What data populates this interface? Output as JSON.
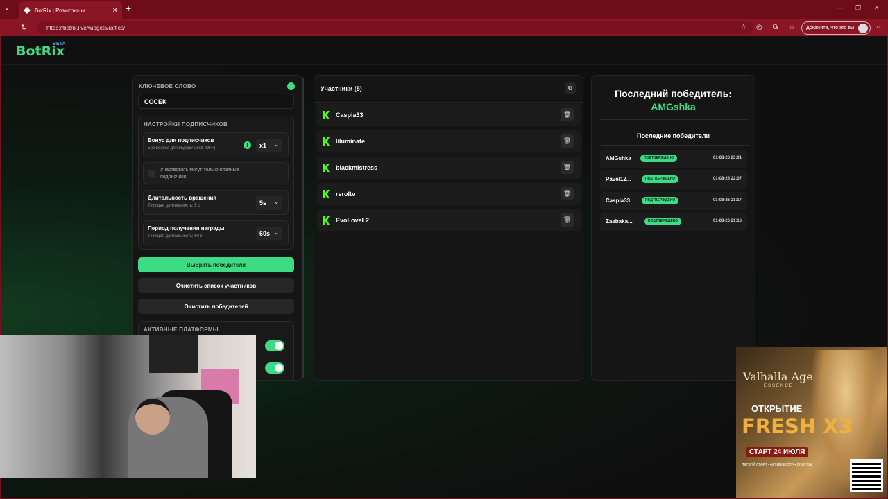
{
  "browser": {
    "tab_title": "BotRix | Розыгрыши",
    "url": "https://botrix.live/widgets/raffles/",
    "profile_label": "Докажите, что это вы"
  },
  "app": {
    "logo": "BotRix",
    "beta": "BETA"
  },
  "settings": {
    "keyword_label": "КЛЮЧЕВОЕ СЛОВО",
    "keyword_value": "COCEK",
    "subs_section": "НАСТРОЙКИ ПОДПИСЧИКОВ",
    "bonus_title": "Бонус для подписчиков",
    "bonus_sub": "Без бонуса для подписчиков (OFF)",
    "bonus_value": "x1",
    "paid_only": "Участвовать могут только платные подписчики",
    "spin_title": "Длительность вращения",
    "spin_sub": "Текущая длительность: 5 с",
    "spin_value": "5s",
    "reward_title": "Период получения награды",
    "reward_sub": "Текущая длительность: 60 с",
    "reward_value": "60s",
    "pick_winner": "Выбрать победителя",
    "clear_participants": "Очистить список участников",
    "clear_winners": "Очистить победителей",
    "platforms_label": "АКТИВНЫЕ ПЛАТФОРМЫ"
  },
  "participants": {
    "title": "Участники (5)",
    "items": [
      "Caspia33",
      "liluminate",
      "blackmistress",
      "reroltv",
      "EvoLoveL2"
    ]
  },
  "winners": {
    "last_label": "Последний победитель:",
    "last_name": "AMGshka",
    "recent_label": "Последние победители",
    "items": [
      {
        "name": "AMGshka",
        "status": "ПОДТВЕРЖДЕНО",
        "date": "01-08-26 23:01"
      },
      {
        "name": "Pavel12...",
        "status": "ПОДТВЕРЖДЕНО",
        "date": "01-08-26 22:07"
      },
      {
        "name": "Caspia33",
        "status": "ПОДТВЕРЖДЕНО",
        "date": "01-08-26 21:17"
      },
      {
        "name": "Zaebaka...",
        "status": "ПОДТВЕРЖДЕНО",
        "date": "01-08-26 21:16"
      }
    ]
  },
  "ad": {
    "brand": "Valhalla Age",
    "brand_sub": "ESSENCE",
    "line1": "ОТКРЫТИЕ",
    "line2": "FRESH X3",
    "line3": "СТАРТ 24 ИЮЛЯ",
    "line4": "ЛЕГКИЙ СТАРТ • АКТИВНОСТИ • БОНУСЫ"
  },
  "colors": {
    "accent": "#3ddc84",
    "browser": "#8a1525",
    "background": "#0f0f0f"
  }
}
